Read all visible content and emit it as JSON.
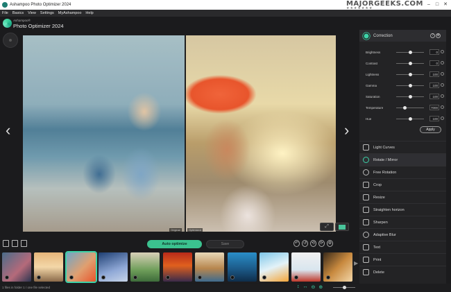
{
  "window": {
    "title": "Ashampoo Photo Optimizer 2024",
    "watermark": "MAJORGEEKS",
    "watermark_sub": ".COM",
    "watermark_stars": "★★★★★★★",
    "controls": [
      "–",
      "□",
      "✕"
    ]
  },
  "menu": [
    "File",
    "Basics",
    "View",
    "Settings",
    "MyAshampoo",
    "Help"
  ],
  "brand": {
    "company": "Ashampoo®",
    "product": "Photo Optimizer 2024"
  },
  "canvas": {
    "label_left": "Original",
    "label_right": "Optimized"
  },
  "correction": {
    "title": "Correction",
    "help_icon": "?",
    "settings_icon": "⚙",
    "sliders": [
      {
        "label": "Brightness",
        "value": "0",
        "level": 0.5
      },
      {
        "label": "Contrast",
        "value": "0",
        "level": 0.5
      },
      {
        "label": "Lightness",
        "value": "100",
        "level": 0.5
      },
      {
        "label": "Gamma",
        "value": "100",
        "level": 0.5
      },
      {
        "label": "Saturation",
        "value": "100",
        "level": 0.5
      },
      {
        "label": "Temperature",
        "value": "7000",
        "level": 0.3
      },
      {
        "label": "Hue",
        "value": "100",
        "level": 0.5
      }
    ],
    "apply_label": "Apply"
  },
  "tools": [
    {
      "label": "Light Curves",
      "icon": "light-curves-icon"
    },
    {
      "label": "Rotate / Mirror",
      "icon": "rotate-icon"
    },
    {
      "label": "Free Rotation",
      "icon": "free-rotation-icon"
    },
    {
      "label": "Crop",
      "icon": "crop-icon"
    },
    {
      "label": "Resize",
      "icon": "resize-icon"
    },
    {
      "label": "Straighten horizon",
      "icon": "horizon-icon"
    },
    {
      "label": "Sharpen",
      "icon": "sharpen-icon"
    },
    {
      "label": "Adaptive Blur",
      "icon": "blur-icon"
    },
    {
      "label": "Text",
      "icon": "text-icon"
    },
    {
      "label": "Print",
      "icon": "print-icon"
    },
    {
      "label": "Delete",
      "icon": "delete-icon"
    }
  ],
  "toolbar": {
    "auto_optimize": "Auto optimize",
    "save": "Save"
  },
  "status": {
    "text": "1 files in folder 1 / one file selected"
  },
  "colors": {
    "accent": "#3bc28f",
    "background": "#1b1b1d",
    "panel": "#232325"
  }
}
